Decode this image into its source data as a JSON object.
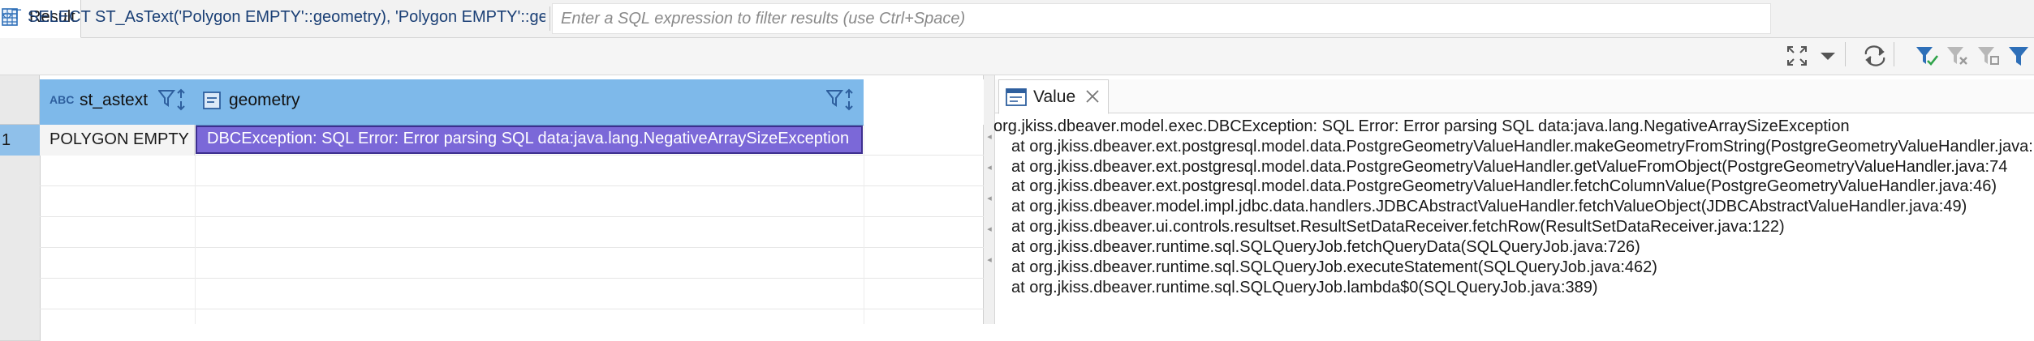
{
  "tab": {
    "label": "Result"
  },
  "filter": {
    "query": "SELECT ST_AsText('Polygon EMPTY'::geometry), 'Polygon EMPTY'::geometry",
    "placeholder": "Enter a SQL expression to filter results (use Ctrl+Space)"
  },
  "grid": {
    "columns": [
      {
        "type_badge": "ABC",
        "name": "st_astext"
      },
      {
        "name": "geometry"
      }
    ],
    "rows": [
      {
        "num": "1",
        "st_astext": "POLYGON EMPTY",
        "geometry": "DBCException: SQL Error: Error parsing SQL data:java.lang.NegativeArraySizeException"
      }
    ]
  },
  "value_panel": {
    "tab_label": "Value",
    "lines": [
      "org.jkiss.dbeaver.model.exec.DBCException: SQL Error: Error parsing SQL data:java.lang.NegativeArraySizeException",
      "at org.jkiss.dbeaver.ext.postgresql.model.data.PostgreGeometryValueHandler.makeGeometryFromString(PostgreGeometryValueHandler.java:",
      "at org.jkiss.dbeaver.ext.postgresql.model.data.PostgreGeometryValueHandler.getValueFromObject(PostgreGeometryValueHandler.java:74",
      "at org.jkiss.dbeaver.ext.postgresql.model.data.PostgreGeometryValueHandler.fetchColumnValue(PostgreGeometryValueHandler.java:46)",
      "at org.jkiss.dbeaver.model.impl.jdbc.data.handlers.JDBCAbstractValueHandler.fetchValueObject(JDBCAbstractValueHandler.java:49)",
      "at org.jkiss.dbeaver.ui.controls.resultset.ResultSetDataReceiver.fetchRow(ResultSetDataReceiver.java:122)",
      "at org.jkiss.dbeaver.runtime.sql.SQLQueryJob.fetchQueryData(SQLQueryJob.java:726)",
      "at org.jkiss.dbeaver.runtime.sql.SQLQueryJob.executeStatement(SQLQueryJob.java:462)",
      "at org.jkiss.dbeaver.runtime.sql.SQLQueryJob.lambda$0(SQLQueryJob.java:389)"
    ]
  },
  "colors": {
    "header_blue": "#7eb9ea",
    "selected_cell": "#7b68d8",
    "accent": "#2e6fb8"
  }
}
